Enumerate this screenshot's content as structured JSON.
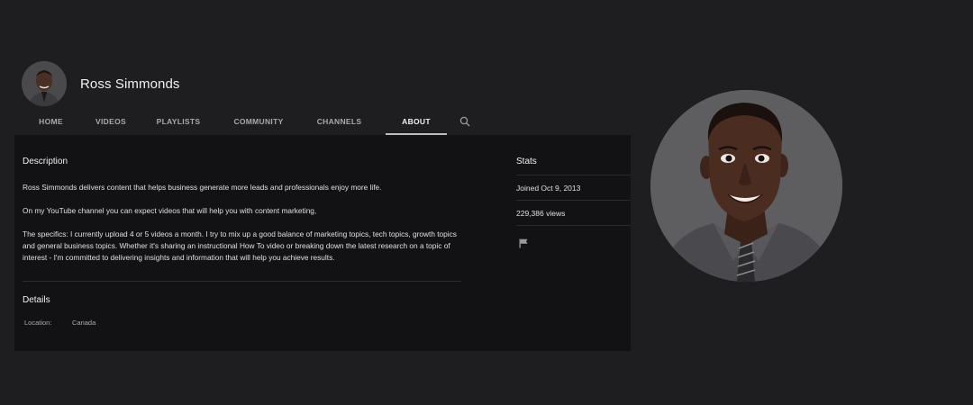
{
  "channel": {
    "name": "Ross Simmonds"
  },
  "tabs": [
    {
      "label": "HOME",
      "active": false
    },
    {
      "label": "VIDEOS",
      "active": false
    },
    {
      "label": "PLAYLISTS",
      "active": false
    },
    {
      "label": "COMMUNITY",
      "active": false
    },
    {
      "label": "CHANNELS",
      "active": false
    },
    {
      "label": "ABOUT",
      "active": true
    }
  ],
  "tab_search_icon": "search-icon",
  "description": {
    "title": "Description",
    "paragraphs": [
      "Ross Simmonds delivers content that helps business generate more leads and professionals enjoy more life.",
      "On my YouTube channel you can expect videos that will help you with content marketing,",
      "The specifics: I currently upload 4 or 5 videos a month. I try to mix up a good balance of marketing topics, tech topics, growth topics and general business topics. Whether it's sharing an instructional How To video or breaking down the latest research on a topic of interest - I'm committed to delivering insights and information that will help you achieve results."
    ]
  },
  "details": {
    "title": "Details",
    "location_label": "Location:",
    "location_value": "Canada"
  },
  "stats": {
    "title": "Stats",
    "joined": "Joined Oct 9, 2013",
    "views": "229,386 views",
    "flag_icon": "flag-icon"
  },
  "colors": {
    "background": "#1e1d1f",
    "panel": "#121114",
    "text": "#e0e0e0",
    "muted": "#a9a9a9",
    "active_underline": "#bdbdbd"
  }
}
